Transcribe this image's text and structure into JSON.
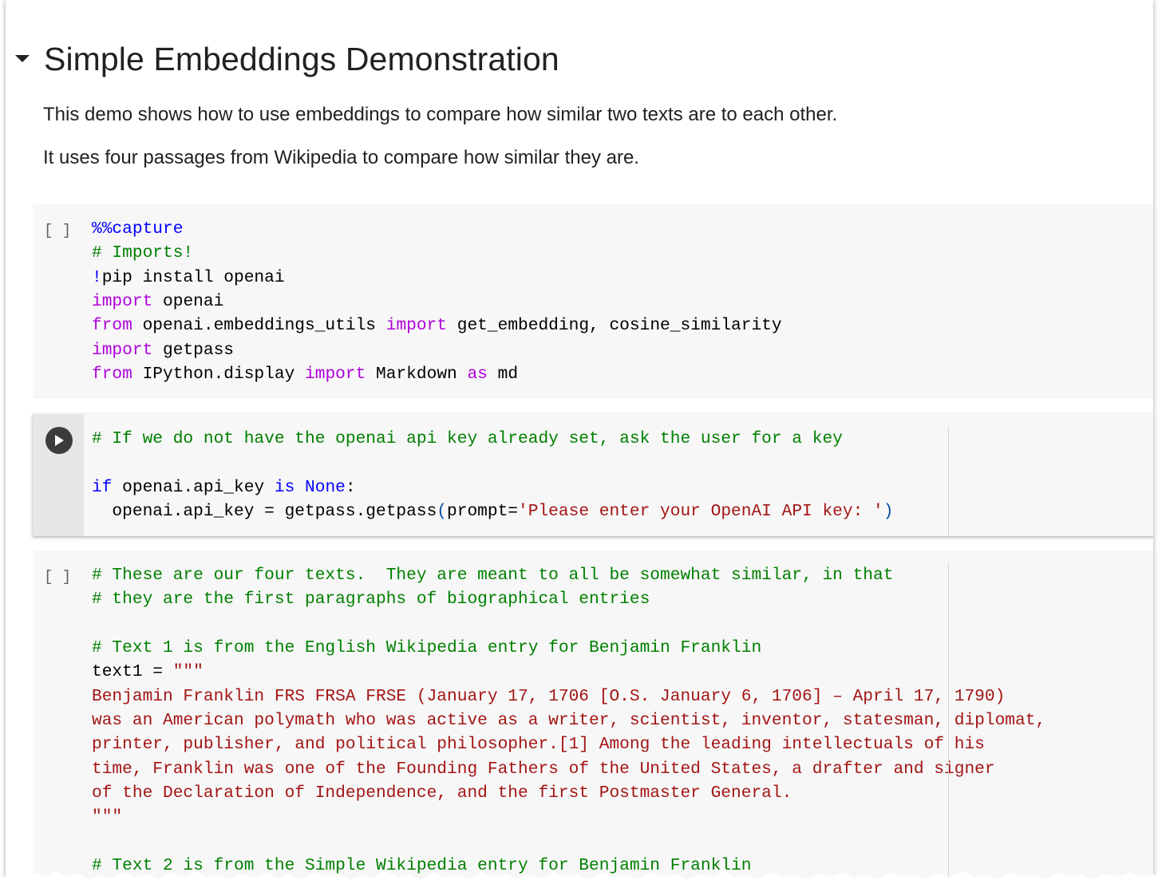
{
  "section": {
    "title": "Simple Embeddings Demonstration",
    "paragraphs": [
      "This demo shows how to use embeddings to compare how similar two texts are to each other.",
      "It uses four passages from Wikipedia to compare how similar they are."
    ]
  },
  "cells": [
    {
      "execution_label": "[ ]",
      "lines": [
        [
          {
            "t": "%%capture",
            "c": "kw-magic"
          }
        ],
        [
          {
            "t": "# Imports!",
            "c": "cm"
          }
        ],
        [
          {
            "t": "!",
            "c": "bang"
          },
          {
            "t": "pip install openai"
          }
        ],
        [
          {
            "t": "import",
            "c": "kw"
          },
          {
            "t": " openai"
          }
        ],
        [
          {
            "t": "from",
            "c": "kw"
          },
          {
            "t": " openai.embeddings_utils "
          },
          {
            "t": "import",
            "c": "kw"
          },
          {
            "t": " get_embedding, cosine_similarity"
          }
        ],
        [
          {
            "t": "import",
            "c": "kw"
          },
          {
            "t": " getpass"
          }
        ],
        [
          {
            "t": "from",
            "c": "kw"
          },
          {
            "t": " IPython.display "
          },
          {
            "t": "import",
            "c": "kw"
          },
          {
            "t": " Markdown "
          },
          {
            "t": "as",
            "c": "kw"
          },
          {
            "t": " md"
          }
        ]
      ]
    },
    {
      "execution_label": "",
      "lines": [
        [
          {
            "t": "# If we do not have the openai api key already set, ask the user for a key",
            "c": "cm"
          }
        ],
        [],
        [
          {
            "t": "if",
            "c": "kw-blue"
          },
          {
            "t": " openai.api_key "
          },
          {
            "t": "is",
            "c": "kw-blue"
          },
          {
            "t": " "
          },
          {
            "t": "None",
            "c": "kw-blue"
          },
          {
            "t": ":"
          }
        ],
        [
          {
            "t": "  openai.api_key = getpass.getpass"
          },
          {
            "t": "(",
            "c": "paren"
          },
          {
            "t": "prompt="
          },
          {
            "t": "'Please enter your OpenAI API key: '",
            "c": "str"
          },
          {
            "t": ")",
            "c": "paren"
          }
        ]
      ]
    },
    {
      "execution_label": "[ ]",
      "lines": [
        [
          {
            "t": "# These are our four texts.  They are meant to all be somewhat similar, in that",
            "c": "cm"
          }
        ],
        [
          {
            "t": "# they are the first paragraphs of biographical entries",
            "c": "cm"
          }
        ],
        [],
        [
          {
            "t": "# Text 1 is from the English Wikipedia entry for Benjamin Franklin",
            "c": "cm"
          }
        ],
        [
          {
            "t": "text1 = "
          },
          {
            "t": "\"\"\"",
            "c": "str"
          }
        ],
        [
          {
            "t": "Benjamin Franklin FRS FRSA FRSE (January 17, 1706 [O.S. January 6, 1706] – April 17, 1790)",
            "c": "str"
          }
        ],
        [
          {
            "t": "was an American polymath who was active as a writer, scientist, inventor, statesman, diplomat,",
            "c": "str"
          }
        ],
        [
          {
            "t": "printer, publisher, and political philosopher.[1] Among the leading intellectuals of his",
            "c": "str"
          }
        ],
        [
          {
            "t": "time, Franklin was one of the Founding Fathers of the United States, a drafter and signer",
            "c": "str"
          }
        ],
        [
          {
            "t": "of the Declaration of Independence, and the first Postmaster General.",
            "c": "str"
          }
        ],
        [
          {
            "t": "\"\"\"",
            "c": "str"
          }
        ],
        [],
        [
          {
            "t": "# Text 2 is from the Simple Wikipedia entry for Benjamin Franklin",
            "c": "cm"
          }
        ]
      ]
    }
  ],
  "icons": {
    "collapse": "caret-down-icon",
    "run": "play-icon"
  }
}
